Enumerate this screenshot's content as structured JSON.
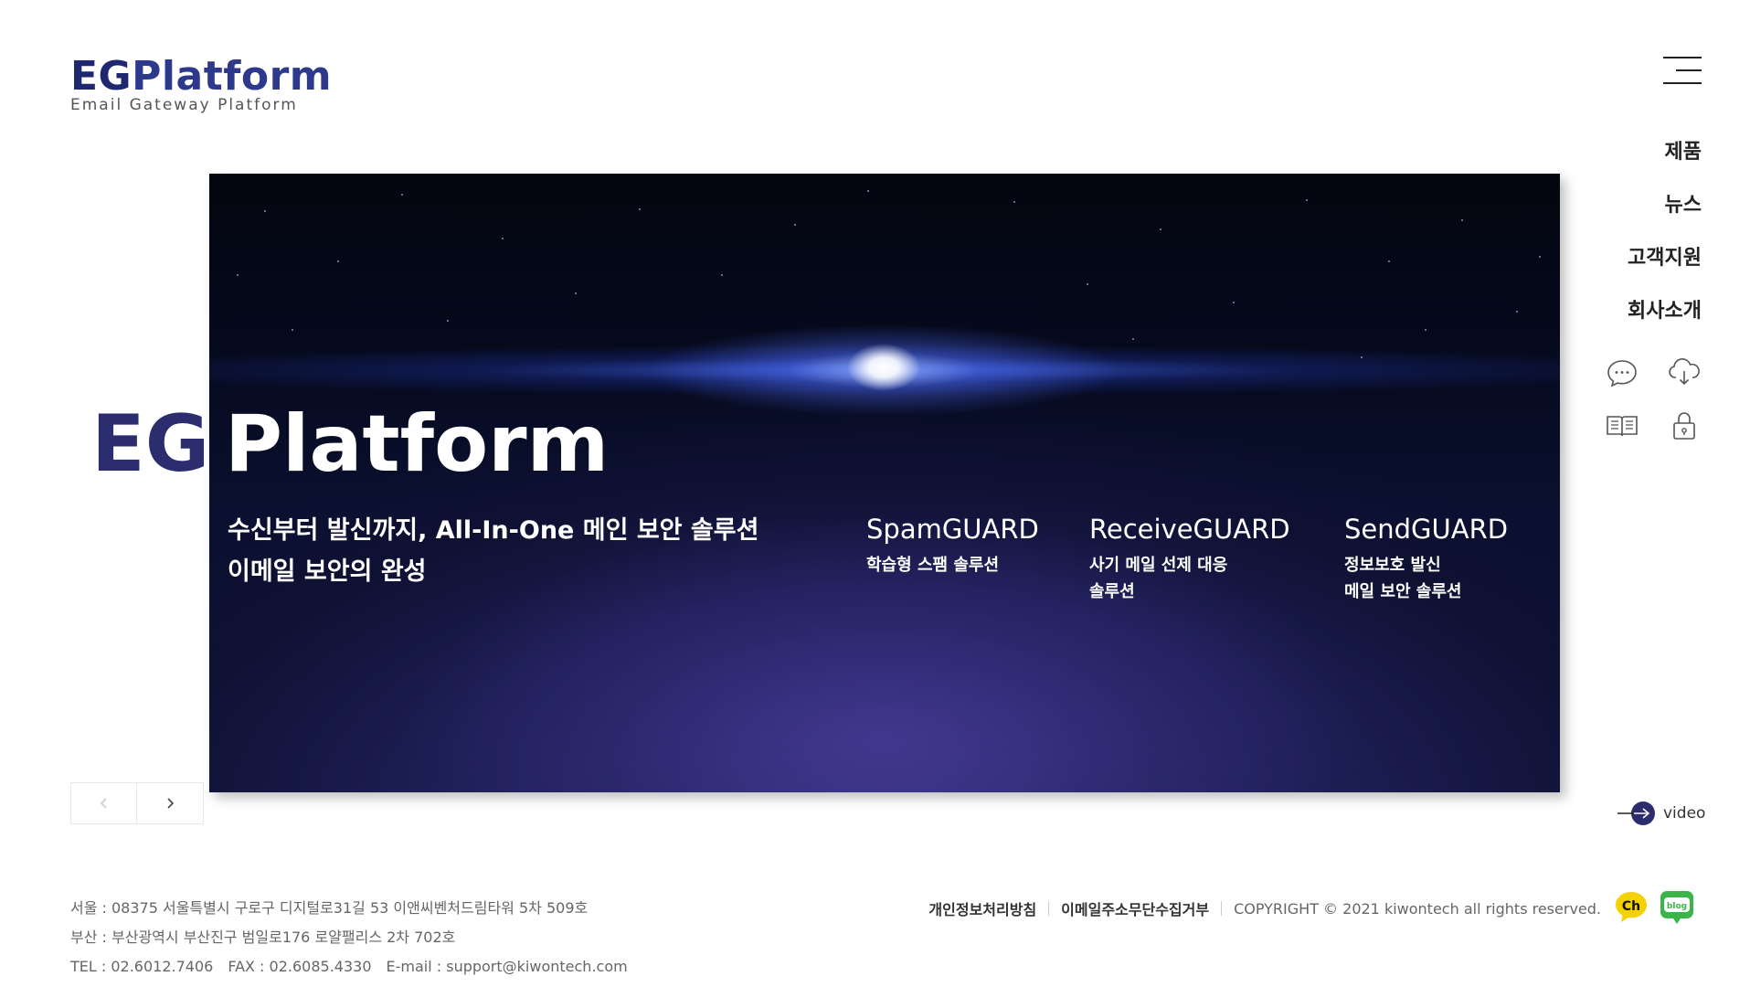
{
  "logo": {
    "eg": "EG",
    "main": "Platform",
    "sub": "Email Gateway Platform"
  },
  "nav": {
    "items": [
      "제품",
      "뉴스",
      "고객지원",
      "회사소개"
    ]
  },
  "quick_icons": [
    "chat-icon",
    "cloud-download-icon",
    "book-icon",
    "lock-icon"
  ],
  "hero": {
    "title_eg": "EG",
    "title_platform": "Platform",
    "sub_line1": "수신부터 발신까지, All-In-One 메인 보안 솔루션",
    "sub_line2": "이메일 보안의 완성"
  },
  "products": [
    {
      "name": "SpamGUARD",
      "desc1": "학습형 스팸 솔루션",
      "desc2": ""
    },
    {
      "name": "ReceiveGUARD",
      "desc1": "사기 메일 선제 대응",
      "desc2": "솔루션"
    },
    {
      "name": "SendGUARD",
      "desc1": "정보보호 발신",
      "desc2": "메일 보안 솔루션"
    }
  ],
  "video": {
    "label": "video"
  },
  "footer": {
    "addr1": "서울 : 08375 서울특별시 구로구 디지털로31길 53 이앤씨벤처드림타워 5차 509호",
    "addr2": "부산 : 부산광역시 부산진구 범일로176 로얄팰리스 2차 702호",
    "tel": "TEL : 02.6012.7406",
    "fax": "FAX : 02.6085.4330",
    "email": "E-mail : support@kiwontech.com",
    "privacy": "개인정보처리방침",
    "email_refuse": "이메일주소무단수집거부",
    "copyright": "COPYRIGHT © 2021 kiwontech all rights reserved."
  },
  "sns": {
    "ch": "Ch",
    "blog": "blog"
  },
  "colors": {
    "brand": "#2d3a8c",
    "navy": "#2b2d6e",
    "blog_green": "#3bb54a",
    "ch_yellow": "#f5d100"
  }
}
